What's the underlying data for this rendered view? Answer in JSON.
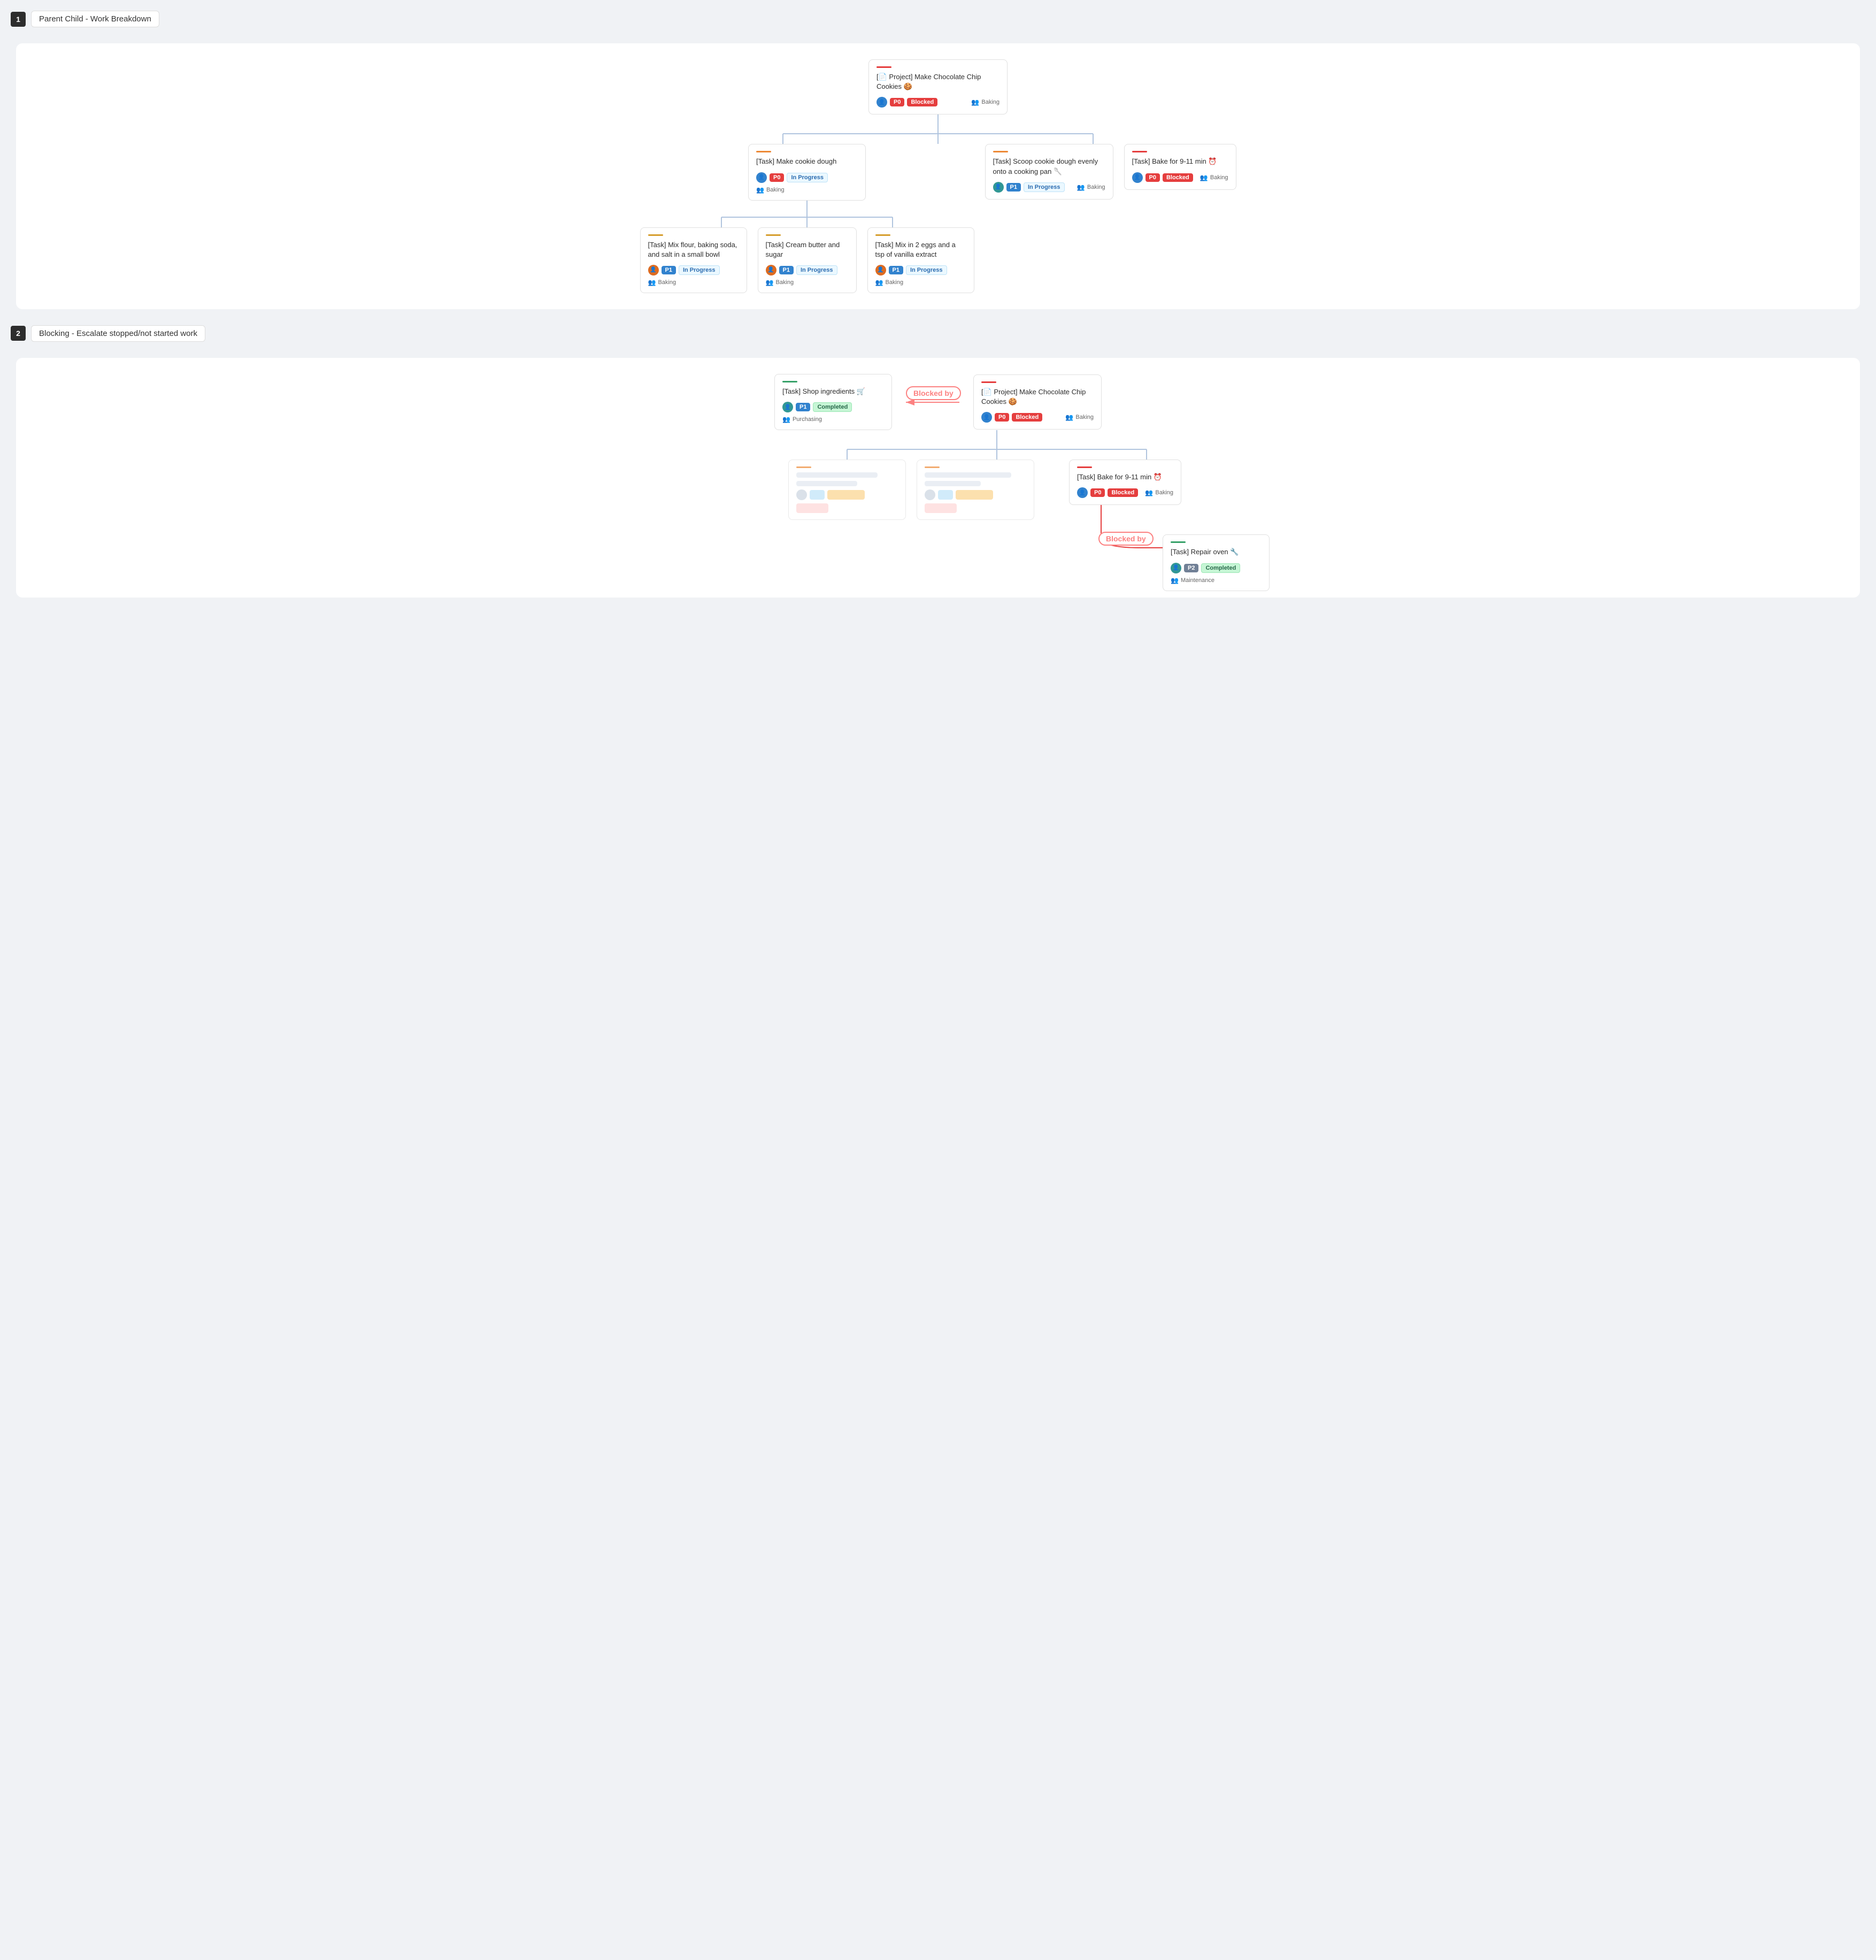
{
  "section1": {
    "number": "1",
    "title": "Parent Child - Work Breakdown",
    "root": {
      "accent": "accent-red",
      "title": "[📄 Project] Make Chocolate Chip Cookies 🍪",
      "avatar": "avatar-blue",
      "avatar_emoji": "👤",
      "priority": "P0",
      "priority_class": "badge-p0",
      "status": "Blocked",
      "status_class": "badge-blocked",
      "team": "Baking"
    },
    "level2": [
      {
        "accent": "accent-orange",
        "title": "[Task] Make cookie dough",
        "avatar": "avatar-blue",
        "priority": "P0",
        "priority_class": "badge-p0",
        "status": "In Progress",
        "status_class": "badge-inprogress",
        "team": "Baking"
      },
      {
        "accent": "accent-orange",
        "title": "[Task] Scoop cookie dough evenly onto a cooking pan 🥄",
        "avatar": "avatar-teal",
        "priority": "P1",
        "priority_class": "badge-p1",
        "status": "In Progress",
        "status_class": "badge-inprogress",
        "team": "Baking"
      },
      {
        "accent": "accent-red",
        "title": "[Task] Bake for 9-11 min ⏰",
        "avatar": "avatar-blue",
        "priority": "P0",
        "priority_class": "badge-p0",
        "status": "Blocked",
        "status_class": "badge-blocked",
        "team": "Baking"
      }
    ],
    "level3": [
      {
        "accent": "accent-yellow",
        "title": "[Task] Mix flour, baking soda, and salt in a small bowl",
        "avatar": "avatar-orange",
        "priority": "P1",
        "priority_class": "badge-p1",
        "status": "In Progress",
        "status_class": "badge-inprogress",
        "team": "Baking"
      },
      {
        "accent": "accent-yellow",
        "title": "[Task] Cream butter and sugar",
        "avatar": "avatar-orange",
        "priority": "P1",
        "priority_class": "badge-p1",
        "status": "In Progress",
        "status_class": "badge-inprogress",
        "team": "Baking"
      },
      {
        "accent": "accent-yellow",
        "title": "[Task] Mix in 2 eggs and a tsp of vanilla extract",
        "avatar": "avatar-orange",
        "priority": "P1",
        "priority_class": "badge-p1",
        "status": "In Progress",
        "status_class": "badge-inprogress",
        "team": "Baking"
      }
    ]
  },
  "section2": {
    "number": "2",
    "title": "Blocking - Escalate stopped/not started work",
    "blocked_by_label": "Blocked by",
    "shop_card": {
      "accent": "accent-green",
      "title": "[Task] Shop ingredients 🛒",
      "avatar": "avatar-teal",
      "priority": "P1",
      "priority_class": "badge-p1",
      "status": "Completed",
      "status_class": "badge-completed",
      "team": "Purchasing"
    },
    "project_card": {
      "accent": "accent-red",
      "title": "[📄 Project] Make Chocolate Chip Cookies 🍪",
      "avatar": "avatar-blue",
      "priority": "P0",
      "priority_class": "badge-p0",
      "status": "Blocked",
      "status_class": "badge-blocked",
      "team": "Baking"
    },
    "bake_card": {
      "accent": "accent-red",
      "title": "[Task] Bake for 9-11 min ⏰",
      "avatar": "avatar-blue",
      "priority": "P0",
      "priority_class": "badge-p0",
      "status": "Blocked",
      "status_class": "badge-blocked",
      "team": "Baking"
    },
    "repair_card": {
      "accent": "accent-green",
      "title": "[Task] Repair oven 🔧",
      "avatar": "avatar-teal",
      "priority": "P2",
      "priority_class": "badge-p2",
      "status": "Completed",
      "status_class": "badge-completed",
      "team": "Maintenance"
    }
  }
}
